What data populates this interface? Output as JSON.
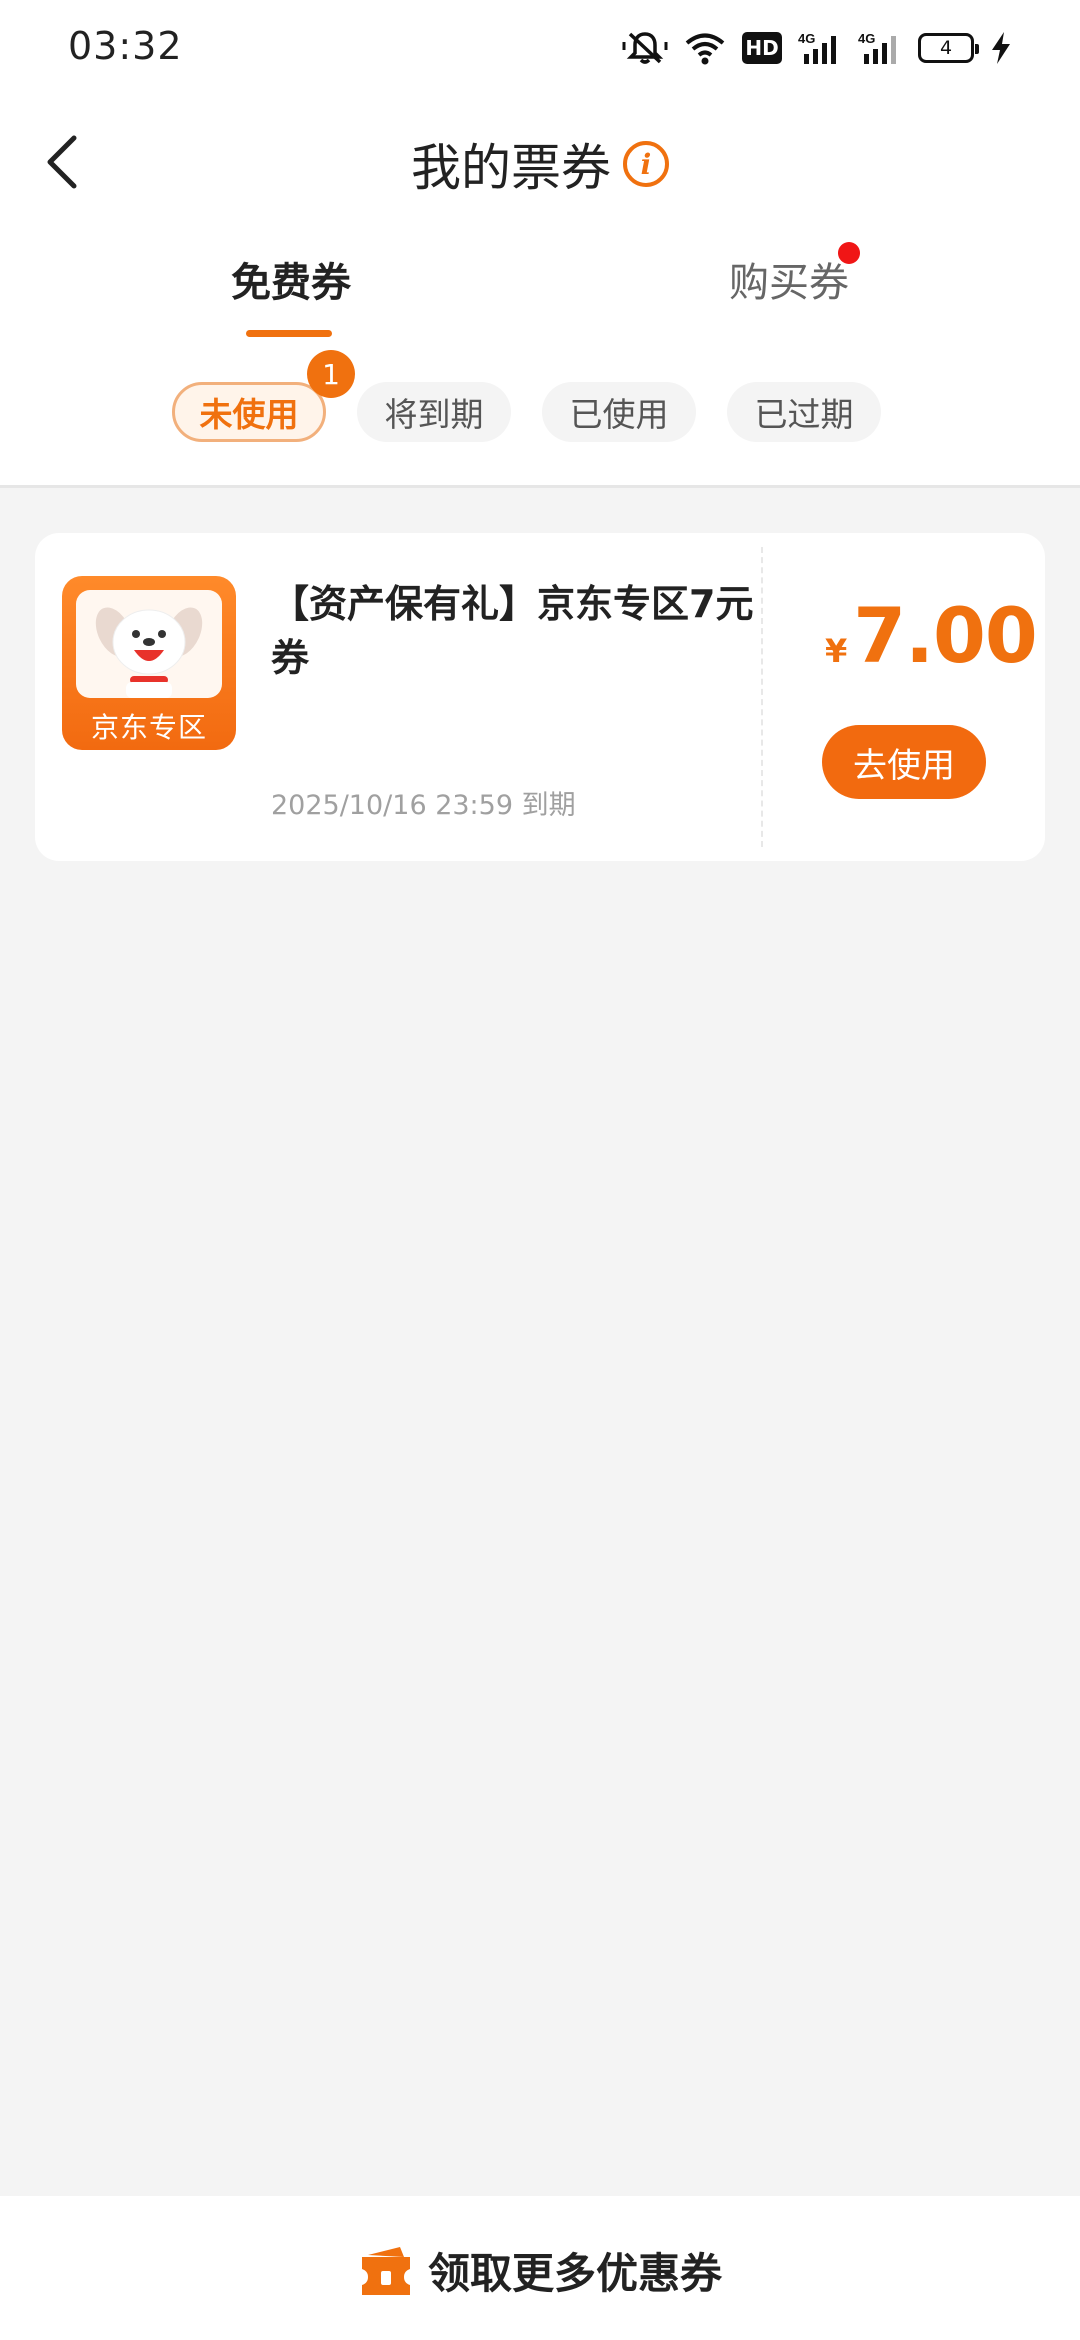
{
  "status_bar": {
    "time": "03:32",
    "hd_label": "HD",
    "network_1": "4G",
    "network_2": "4G",
    "battery_level": "4",
    "icons": [
      "mute-icon",
      "wifi-icon",
      "hd-icon",
      "signal-4g-icon",
      "signal-4g-icon",
      "battery-icon",
      "charging-icon"
    ]
  },
  "header": {
    "title": "我的票券",
    "info_icon": "i"
  },
  "tabs": [
    {
      "label": "免费券",
      "active": true
    },
    {
      "label": "购买券",
      "active": false,
      "has_red_dot": true
    }
  ],
  "filters": {
    "chips": [
      {
        "label": "未使用",
        "active": true
      },
      {
        "label": "将到期",
        "active": false
      },
      {
        "label": "已使用",
        "active": false
      },
      {
        "label": "已过期",
        "active": false
      }
    ],
    "unused_count": "1"
  },
  "coupon": {
    "thumb_label": "京东专区",
    "title": "【资产保有礼】京东专区7元券",
    "expiry": "2025/10/16 23:59 到期",
    "currency": "¥",
    "amount": "7.00",
    "use_button": "去使用"
  },
  "bottom_bar": {
    "label": "领取更多优惠券"
  },
  "colors": {
    "accent": "#f0710f",
    "red_dot": "#f01616",
    "background": "#f4f4f4"
  }
}
